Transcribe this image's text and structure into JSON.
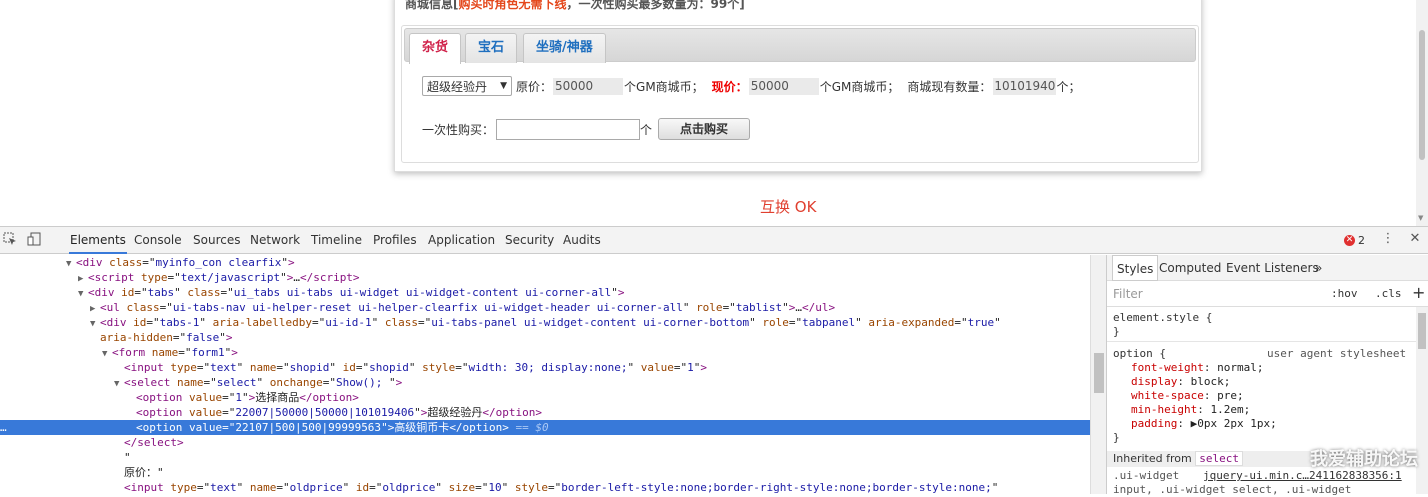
{
  "shop": {
    "notice_prefix": "商城信息[",
    "notice_highlight": "购买时角色无需下线",
    "notice_suffix": "，一次性购买最多数量为：99个]",
    "tabs": [
      {
        "label": "杂货",
        "active": true
      },
      {
        "label": "宝石",
        "active": false
      },
      {
        "label": "坐骑/神器",
        "active": false
      }
    ],
    "select_value": "超级经验丹",
    "original_price_label": "原价：",
    "original_price": "50000",
    "currency_1": "个GM商城币；",
    "current_price_label": "现价：",
    "current_price": "50000",
    "currency_2": "个GM商城币；",
    "stock_label": "商城现有数量：",
    "stock_value": "10101940",
    "stock_unit": "个；",
    "buy_qty_label": "一次性购买：",
    "buy_qty_value": "",
    "buy_qty_unit": "个",
    "buy_button": "点击购买",
    "swap_ok": "互换 OK"
  },
  "devtools": {
    "tabs": [
      "Elements",
      "Console",
      "Sources",
      "Network",
      "Timeline",
      "Profiles",
      "Application",
      "Security",
      "Audits"
    ],
    "active_tab": "Elements",
    "error_count": "2",
    "styles_tabs": [
      "Styles",
      "Computed",
      "Event Listeners"
    ],
    "more_tabs": "»",
    "filter_placeholder": "Filter",
    "hov": ":hov",
    "cls": ".cls",
    "element_style": "element.style {",
    "close_brace": "}",
    "option_selector": "option {",
    "user_agent_label": "user agent stylesheet",
    "props": [
      {
        "name": "font-weight",
        "value": "normal;"
      },
      {
        "name": "display",
        "value": "block;"
      },
      {
        "name": "white-space",
        "value": "pre;"
      },
      {
        "name": "min-height",
        "value": "1.2em;"
      },
      {
        "name": "padding",
        "value": "▶0px 2px 1px;"
      }
    ],
    "inherited_label": "Inherited from",
    "inherited_tag": "select",
    "ui_widget_line": ".ui-widget",
    "ui_widget_source": "jquery-ui.min.c…241162838356:1",
    "ui_widget_line2": "input, .ui-widget select, .ui-widget",
    "dom_lines": [
      {
        "indent": 4,
        "tri": "▼",
        "html": "<span class='tag'>&lt;div</span> <span class='an'>class</span>=\"<span class='av'>myinfo_con clearfix</span>\"<span class='tag'>&gt;</span>"
      },
      {
        "indent": 5,
        "tri": "▶",
        "html": "<span class='tag'>&lt;script</span> <span class='an'>type</span>=\"<span class='av'>text/javascript</span>\"<span class='tag'>&gt;</span>…<span class='tag'>&lt;/script&gt;</span>"
      },
      {
        "indent": 5,
        "tri": "▼",
        "html": "<span class='tag'>&lt;div</span> <span class='an'>id</span>=\"<span class='av'>tabs</span>\" <span class='an'>class</span>=\"<span class='av'>ui_tabs ui-tabs ui-widget ui-widget-content ui-corner-all</span>\"<span class='tag'>&gt;</span>"
      },
      {
        "indent": 6,
        "tri": "▶",
        "html": "<span class='tag'>&lt;ul</span> <span class='an'>class</span>=\"<span class='av'>ui-tabs-nav ui-helper-reset ui-helper-clearfix ui-widget-header ui-corner-all</span>\" <span class='an'>role</span>=\"<span class='av'>tablist</span>\"<span class='tag'>&gt;</span>…<span class='tag'>&lt;/ul&gt;</span>"
      },
      {
        "indent": 6,
        "tri": "▼",
        "html": "<span class='tag'>&lt;div</span> <span class='an'>id</span>=\"<span class='av'>tabs-1</span>\" <span class='an'>aria-labelledby</span>=\"<span class='av'>ui-id-1</span>\" <span class='an'>class</span>=\"<span class='av'>ui-tabs-panel ui-widget-content ui-corner-bottom</span>\" <span class='an'>role</span>=\"<span class='av'>tabpanel</span>\" <span class='an'>aria-expanded</span>=\"<span class='av'>true</span>\""
      },
      {
        "indent": 6,
        "tri": "",
        "html": "<span class='an'>aria-hidden</span>=\"<span class='av'>false</span>\"<span class='tag'>&gt;</span>"
      },
      {
        "indent": 7,
        "tri": "▼",
        "html": "<span class='tag'>&lt;form</span> <span class='an'>name</span>=\"<span class='av'>form1</span>\"<span class='tag'>&gt;</span>"
      },
      {
        "indent": 8,
        "tri": "",
        "html": "<span class='tag'>&lt;input</span> <span class='an'>type</span>=\"<span class='av'>text</span>\" <span class='an'>name</span>=\"<span class='av'>shopid</span>\" <span class='an'>id</span>=\"<span class='av'>shopid</span>\" <span class='an'>style</span>=\"<span class='av'>width: 30; display:none;</span>\" <span class='an'>value</span>=\"<span class='av'>1</span>\"<span class='tag'>&gt;</span>"
      },
      {
        "indent": 8,
        "tri": "▼",
        "html": "<span class='tag'>&lt;select</span> <span class='an'>name</span>=\"<span class='av'>select</span>\" <span class='an'>onchange</span>=\"<span class='av'>Show(); </span>\"<span class='tag'>&gt;</span>"
      },
      {
        "indent": 9,
        "tri": "",
        "html": "<span class='tag'>&lt;option</span> <span class='an'>value</span>=\"<span class='av'>1</span>\"<span class='tag'>&gt;</span>选择商品<span class='tag'>&lt;/option&gt;</span>"
      },
      {
        "indent": 9,
        "tri": "",
        "html": "<span class='tag'>&lt;option</span> <span class='an'>value</span>=\"<span class='av'>22007|50000|50000|101019406</span>\"<span class='tag'>&gt;</span>超级经验丹<span class='tag'>&lt;/option&gt;</span>"
      },
      {
        "indent": 9,
        "tri": "",
        "selected": true,
        "html": "<span class='tag'>&lt;option</span> <span class='an'>value</span>=\"<span class='av'>22107|500|500|99999563</span>\"<span class='tag'>&gt;</span>高级铜币卡<span class='tag'>&lt;/option&gt;</span> <span class='dim'>== $0</span>"
      },
      {
        "indent": 8,
        "tri": "",
        "html": "<span class='tag'>&lt;/select&gt;</span>"
      },
      {
        "indent": 8,
        "tri": "",
        "html": "\""
      },
      {
        "indent": 8,
        "tri": "",
        "html": "原价：\""
      },
      {
        "indent": 8,
        "tri": "",
        "html": "<span class='tag'>&lt;input</span> <span class='an'>type</span>=\"<span class='av'>text</span>\" <span class='an'>name</span>=\"<span class='av'>oldprice</span>\" <span class='an'>id</span>=\"<span class='av'>oldprice</span>\" <span class='an'>size</span>=\"<span class='av'>10</span>\" <span class='an'>style</span>=\"<span class='av'>border-left-style:none;border-right-style:none;border-style:none;</span>\""
      }
    ]
  },
  "watermark": "我爱辅助论坛",
  "colors": {
    "selected_row": "#3879d9",
    "active_tab_text": "#d0224a",
    "tab_text": "#1f6fbf",
    "red_price": "#e00000"
  }
}
